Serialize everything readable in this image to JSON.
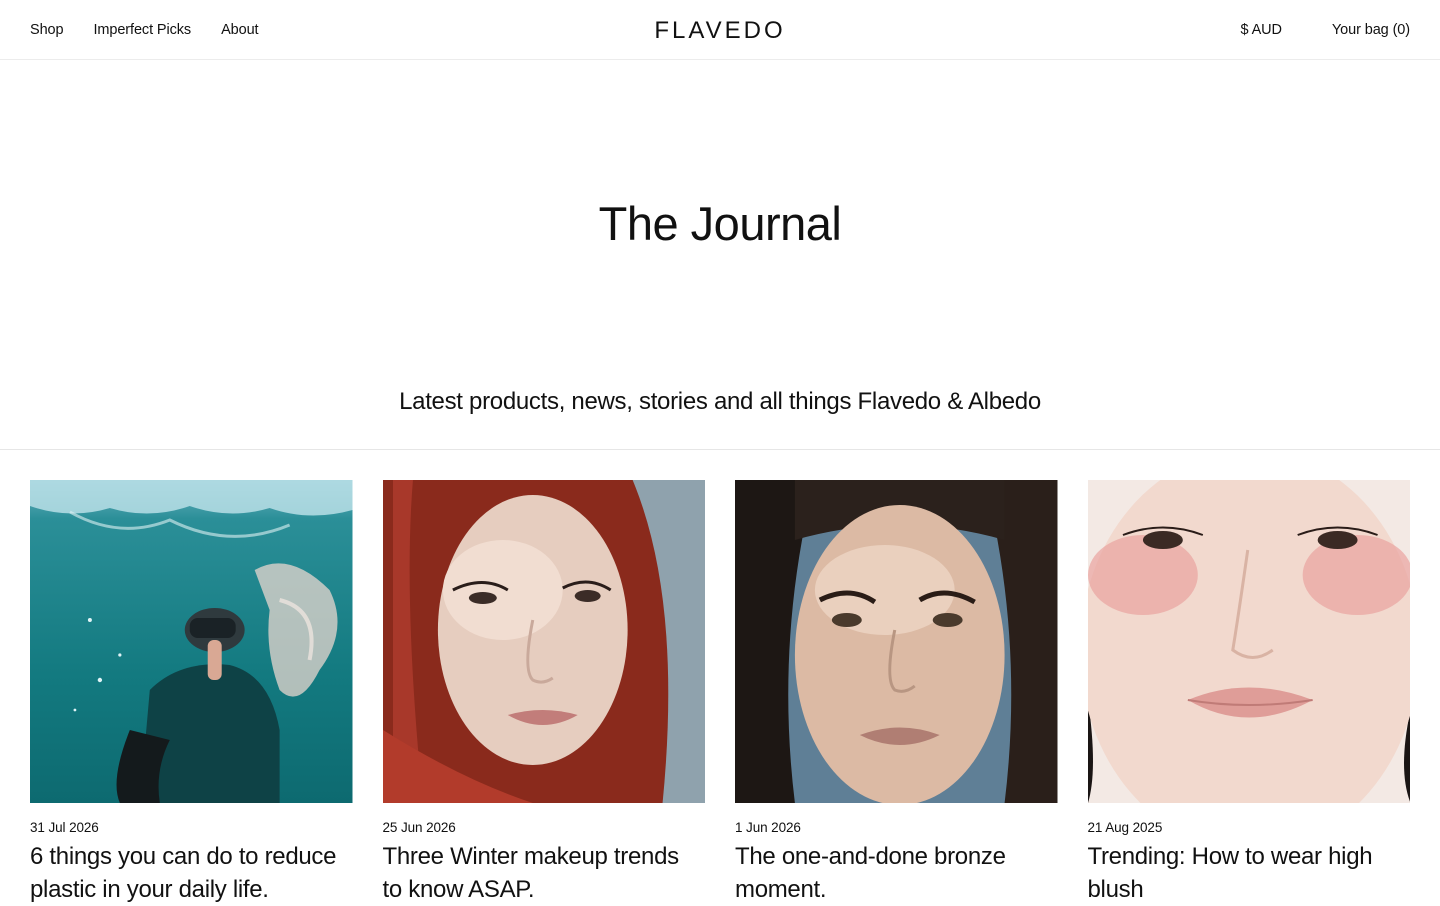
{
  "header": {
    "nav": [
      "Shop",
      "Imperfect Picks",
      "About"
    ],
    "brand": "FLAVEDO",
    "currency": "$ AUD",
    "bag": "Your bag (0)"
  },
  "hero": {
    "title": "The Journal",
    "subtitle": "Latest products, news, stories and all things Flavedo & Albedo"
  },
  "articles": [
    {
      "date": "31 Jul 2026",
      "title": "6 things you can do to reduce plastic in your daily life."
    },
    {
      "date": "25 Jun 2026",
      "title": "Three Winter makeup trends to know ASAP."
    },
    {
      "date": "1 Jun 2026",
      "title": "The one-and-done bronze moment."
    },
    {
      "date": "21 Aug 2025",
      "title": "Trending: How to wear high blush"
    }
  ]
}
